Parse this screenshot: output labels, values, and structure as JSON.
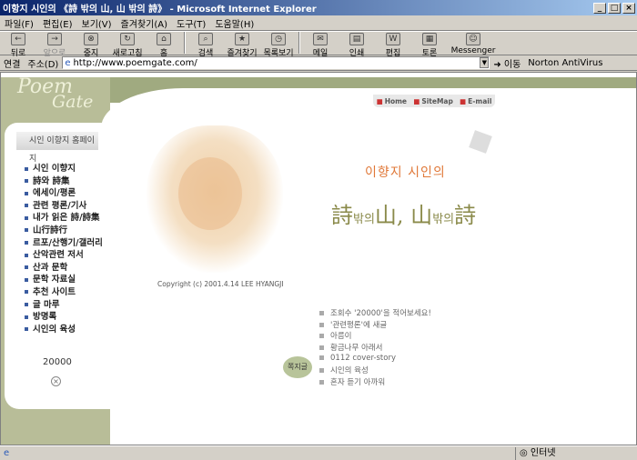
{
  "window": {
    "title": "이항지 시인의 《詩 밖의 山, 山 밖의 詩》 - Microsoft Internet Explorer"
  },
  "menu": [
    "파일(F)",
    "편집(E)",
    "보기(V)",
    "즐겨찾기(A)",
    "도구(T)",
    "도움말(H)"
  ],
  "toolbar": {
    "back": "뒤로",
    "forward": "앞으로",
    "stop": "중지",
    "refresh": "새로고침",
    "home": "홈",
    "search": "검색",
    "favorites": "즐겨찾기",
    "history": "목록보기",
    "mail": "메일",
    "print": "인쇄",
    "edit": "편집",
    "discuss": "토론",
    "messenger": "Messenger"
  },
  "addressbar": {
    "links": "연결",
    "label": "주소(D)",
    "url": "http://www.poemgate.com/",
    "go": "이동",
    "antivirus": "Norton AntiVirus"
  },
  "page": {
    "logo_line1": "Poem",
    "logo_line2": "Gate",
    "home_btn": "시인 이향지 홈페이지",
    "top_links": [
      "Home",
      "SiteMap",
      "E-mail"
    ],
    "nav": [
      "시인 이향지",
      "詩와 詩集",
      "에세이/평론",
      "관련 평론/기사",
      "내가 읽은 詩/詩集",
      "山行詩行",
      "르포/산행기/갤러리",
      "산악관련 저서",
      "산과 문학",
      "문학 자료실",
      "추천 사이트",
      "글 마루",
      "방명록",
      "시인의 육성"
    ],
    "counter": "20000",
    "poet_name": "이향지 시인의",
    "tagline_1": "詩",
    "tagline_2": "밖의",
    "tagline_3": "山, 山",
    "tagline_4": "밖의",
    "tagline_5": "詩",
    "copyright": "Copyright (c) 2001.4.14   LEE HYANGJI",
    "latest": [
      "조회수 '20000'을 적어보세요!",
      "'관련평론'에 새글",
      "아름이",
      "황금나무 아래서",
      "0112 cover-story",
      "시인의 육성",
      "혼자 듣기 아까워"
    ],
    "jjk_btn": "쪽지글"
  },
  "statusbar": {
    "zone": "인터넷"
  }
}
